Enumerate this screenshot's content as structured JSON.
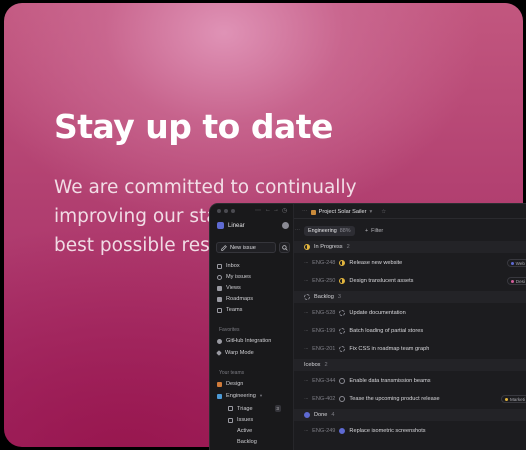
{
  "hero": {
    "headline": "Stay up to date",
    "subtext": "We are committed to continually improving our starter kit and providing the best possible resources"
  },
  "app": {
    "window_controls": {
      "menu": "⋯",
      "nav_prev": "←",
      "nav_next": "→",
      "history": "◷"
    },
    "sidebar": {
      "workspace": "Linear",
      "new_issue": "New issue",
      "items": [
        {
          "label": "Inbox",
          "icon": "inbox-icon"
        },
        {
          "label": "My issues",
          "icon": "issues-icon"
        },
        {
          "label": "Views",
          "icon": "views-icon"
        },
        {
          "label": "Roadmaps",
          "icon": "roadmap-icon"
        },
        {
          "label": "Teams",
          "icon": "teams-icon"
        }
      ],
      "favorites_label": "Favorites",
      "favorites": [
        {
          "label": "GitHub Integration",
          "icon": "github-icon"
        },
        {
          "label": "Warp Mode",
          "icon": "warp-icon"
        }
      ],
      "teams_label": "Your teams",
      "teams": [
        {
          "label": "Design"
        },
        {
          "label": "Engineering",
          "children": [
            {
              "label": "Triage",
              "badge": "3"
            },
            {
              "label": "Issues"
            },
            {
              "label": "Active"
            },
            {
              "label": "Backlog"
            }
          ]
        }
      ]
    },
    "main": {
      "project": "Project Solar Sailer",
      "tab": {
        "label": "Engineering",
        "percent": "88%"
      },
      "filter": "Filter",
      "groups": [
        {
          "name": "In Progress",
          "count": "2",
          "status": "inprogress",
          "rows": [
            {
              "id": "ENG-248",
              "title": "Release new website",
              "tag": "Web",
              "tag_color": "#5e6ad2"
            },
            {
              "id": "ENG-250",
              "title": "Design translucent assets",
              "tag": "Desi",
              "tag_color": "#d25e9a"
            }
          ]
        },
        {
          "name": "Backlog",
          "count": "3",
          "status": "backlog",
          "rows": [
            {
              "id": "ENG-528",
              "title": "Update documentation"
            },
            {
              "id": "ENG-199",
              "title": "Batch loading of partial stores"
            },
            {
              "id": "ENG-201",
              "title": "Fix CSS in roadmap team graph"
            }
          ]
        },
        {
          "name": "Icebox",
          "count": "2",
          "status": "todo",
          "rows": [
            {
              "id": "ENG-344",
              "title": "Enable data transmission beams"
            },
            {
              "id": "ENG-402",
              "title": "Tease the upcoming product release",
              "tag": "Marketi",
              "tag_color": "#e2b53e"
            }
          ]
        },
        {
          "name": "Done",
          "count": "4",
          "status": "done",
          "rows": [
            {
              "id": "ENG-249",
              "title": "Replace isometric screenshots"
            }
          ]
        }
      ]
    }
  }
}
